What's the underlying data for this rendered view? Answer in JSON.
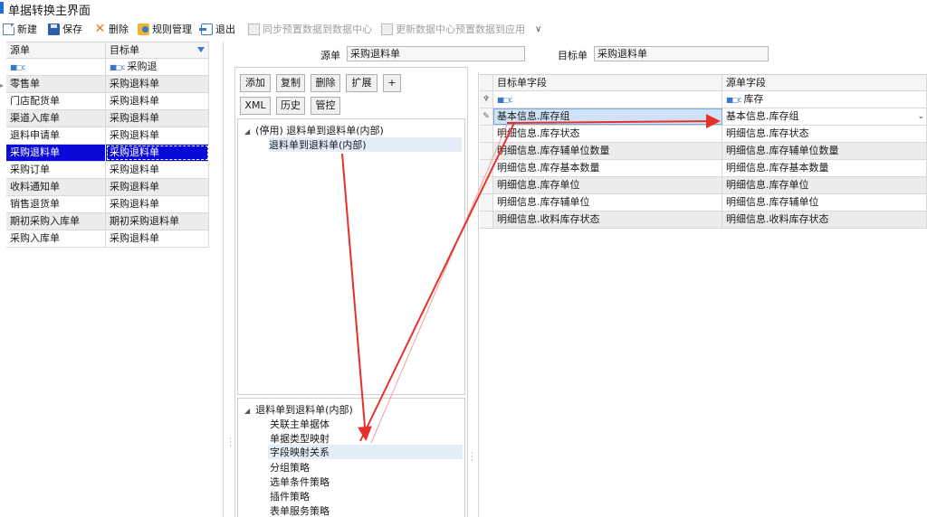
{
  "window": {
    "title": "单据转换主界面"
  },
  "toolbar": {
    "new": "新建",
    "save": "保存",
    "delete": "删除",
    "rules": "规则管理",
    "exit": "退出",
    "sync_preset": "同步预置数据到数据中心",
    "update_app": "更新数据中心预置数据到应用",
    "more_icon": "chevron-down-icon"
  },
  "left_grid": {
    "headers": [
      "源单",
      "目标单"
    ],
    "filter_row": {
      "target_filter": "采购退"
    },
    "rows": [
      {
        "source": "零售单",
        "target": "采购退料单"
      },
      {
        "source": "门店配货单",
        "target": "采购退料单"
      },
      {
        "source": "渠道入库单",
        "target": "采购退料单"
      },
      {
        "source": "退料申请单",
        "target": "采购退料单"
      },
      {
        "source": "采购退料单",
        "target": "采购退料单"
      },
      {
        "source": "采购订单",
        "target": "采购退料单"
      },
      {
        "source": "收料通知单",
        "target": "采购退料单"
      },
      {
        "source": "销售退货单",
        "target": "采购退料单"
      },
      {
        "source": "期初采购入库单",
        "target": "期初采购退料单"
      },
      {
        "source": "采购入库单",
        "target": "采购退料单"
      }
    ]
  },
  "header": {
    "source_label": "源单",
    "source_value": "采购退料单",
    "target_label": "目标单",
    "target_value": "采购退料单"
  },
  "middle": {
    "buttons": [
      "添加",
      "复制",
      "删除",
      "扩展",
      "+",
      "XML",
      "历史",
      "管控"
    ],
    "rule_tree": {
      "parent": "(停用) 退料单到退料单(内部)",
      "child": "退料单到退料单(内部)"
    },
    "policy_tree": {
      "parent": "退料单到退料单(内部)",
      "items": [
        "关联主单据体",
        "单据类型映射",
        "字段映射关系",
        "分组策略",
        "选单条件策略",
        "插件策略",
        "表单服务策略"
      ],
      "selected": "字段映射关系"
    }
  },
  "right_grid": {
    "headers": [
      "目标单字段",
      "源单字段"
    ],
    "filter_row": {
      "source_filter": "库存"
    },
    "rows": [
      {
        "target": "基本信息.库存组",
        "source": "基本信息.库存组"
      },
      {
        "target": "明细信息.库存状态",
        "source": "明细信息.库存状态"
      },
      {
        "target": "明细信息.库存辅单位数量",
        "source": "明细信息.库存辅单位数量"
      },
      {
        "target": "明细信息.库存基本数量",
        "source": "明细信息.库存基本数量"
      },
      {
        "target": "明细信息.库存单位",
        "source": "明细信息.库存单位"
      },
      {
        "target": "明细信息.库存辅单位",
        "source": "明细信息.库存辅单位"
      },
      {
        "target": "明细信息.收料库存状态",
        "source": "明细信息.收料库存状态"
      }
    ]
  },
  "colors": {
    "accent": "#1e6fd9",
    "selection": "#0a0ad8",
    "annotation_arrow": "#e8302a"
  }
}
